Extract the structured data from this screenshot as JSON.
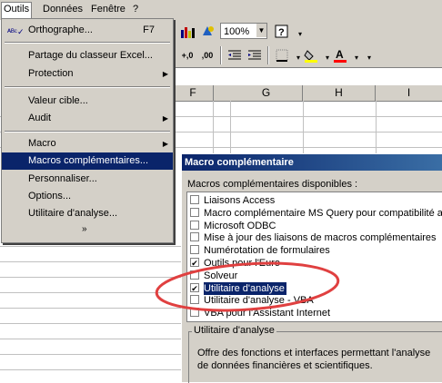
{
  "menubar": {
    "outils": "Outils",
    "donnees": "Données",
    "fenetre": "Fenêtre",
    "help": "?"
  },
  "toolbar": {
    "zoom": "100%"
  },
  "columns": [
    "F",
    "G",
    "H",
    "I"
  ],
  "menu": {
    "items": [
      {
        "label": "Orthographe...",
        "shortcut": "F7"
      },
      {
        "label": "Partage du classeur Excel..."
      },
      {
        "label": "Protection"
      },
      {
        "label": "Valeur cible..."
      },
      {
        "label": "Audit"
      },
      {
        "label": "Macro"
      },
      {
        "label": "Macros complémentaires..."
      },
      {
        "label": "Personnaliser..."
      },
      {
        "label": "Options..."
      },
      {
        "label": "Utilitaire d'analyse..."
      }
    ],
    "expand": "»"
  },
  "dialog": {
    "title": "Macro complémentaire",
    "list_label": "Macros complémentaires disponibles :",
    "addins": [
      {
        "name": "Liaisons Access",
        "checked": false
      },
      {
        "name": "Macro complémentaire MS Query pour compatibilité ave",
        "checked": false
      },
      {
        "name": "Microsoft ODBC",
        "checked": false
      },
      {
        "name": "Mise à jour des liaisons de macros complémentaires",
        "checked": false
      },
      {
        "name": "Numérotation de formulaires",
        "checked": false
      },
      {
        "name": "Outils pour l'Euro",
        "checked": true
      },
      {
        "name": "Solveur",
        "checked": false
      },
      {
        "name": "Utilitaire d'analyse",
        "checked": true
      },
      {
        "name": "Utilitaire d'analyse - VBA",
        "checked": false
      },
      {
        "name": "VBA pour l'Assistant Internet",
        "checked": false
      }
    ],
    "group_label": "Utilitaire d'analyse",
    "description": "Offre des fonctions et interfaces permettant l'analyse de données financières et scientifiques."
  },
  "colors": {
    "highlight": "#0a246a",
    "annotation": "#e04040"
  }
}
